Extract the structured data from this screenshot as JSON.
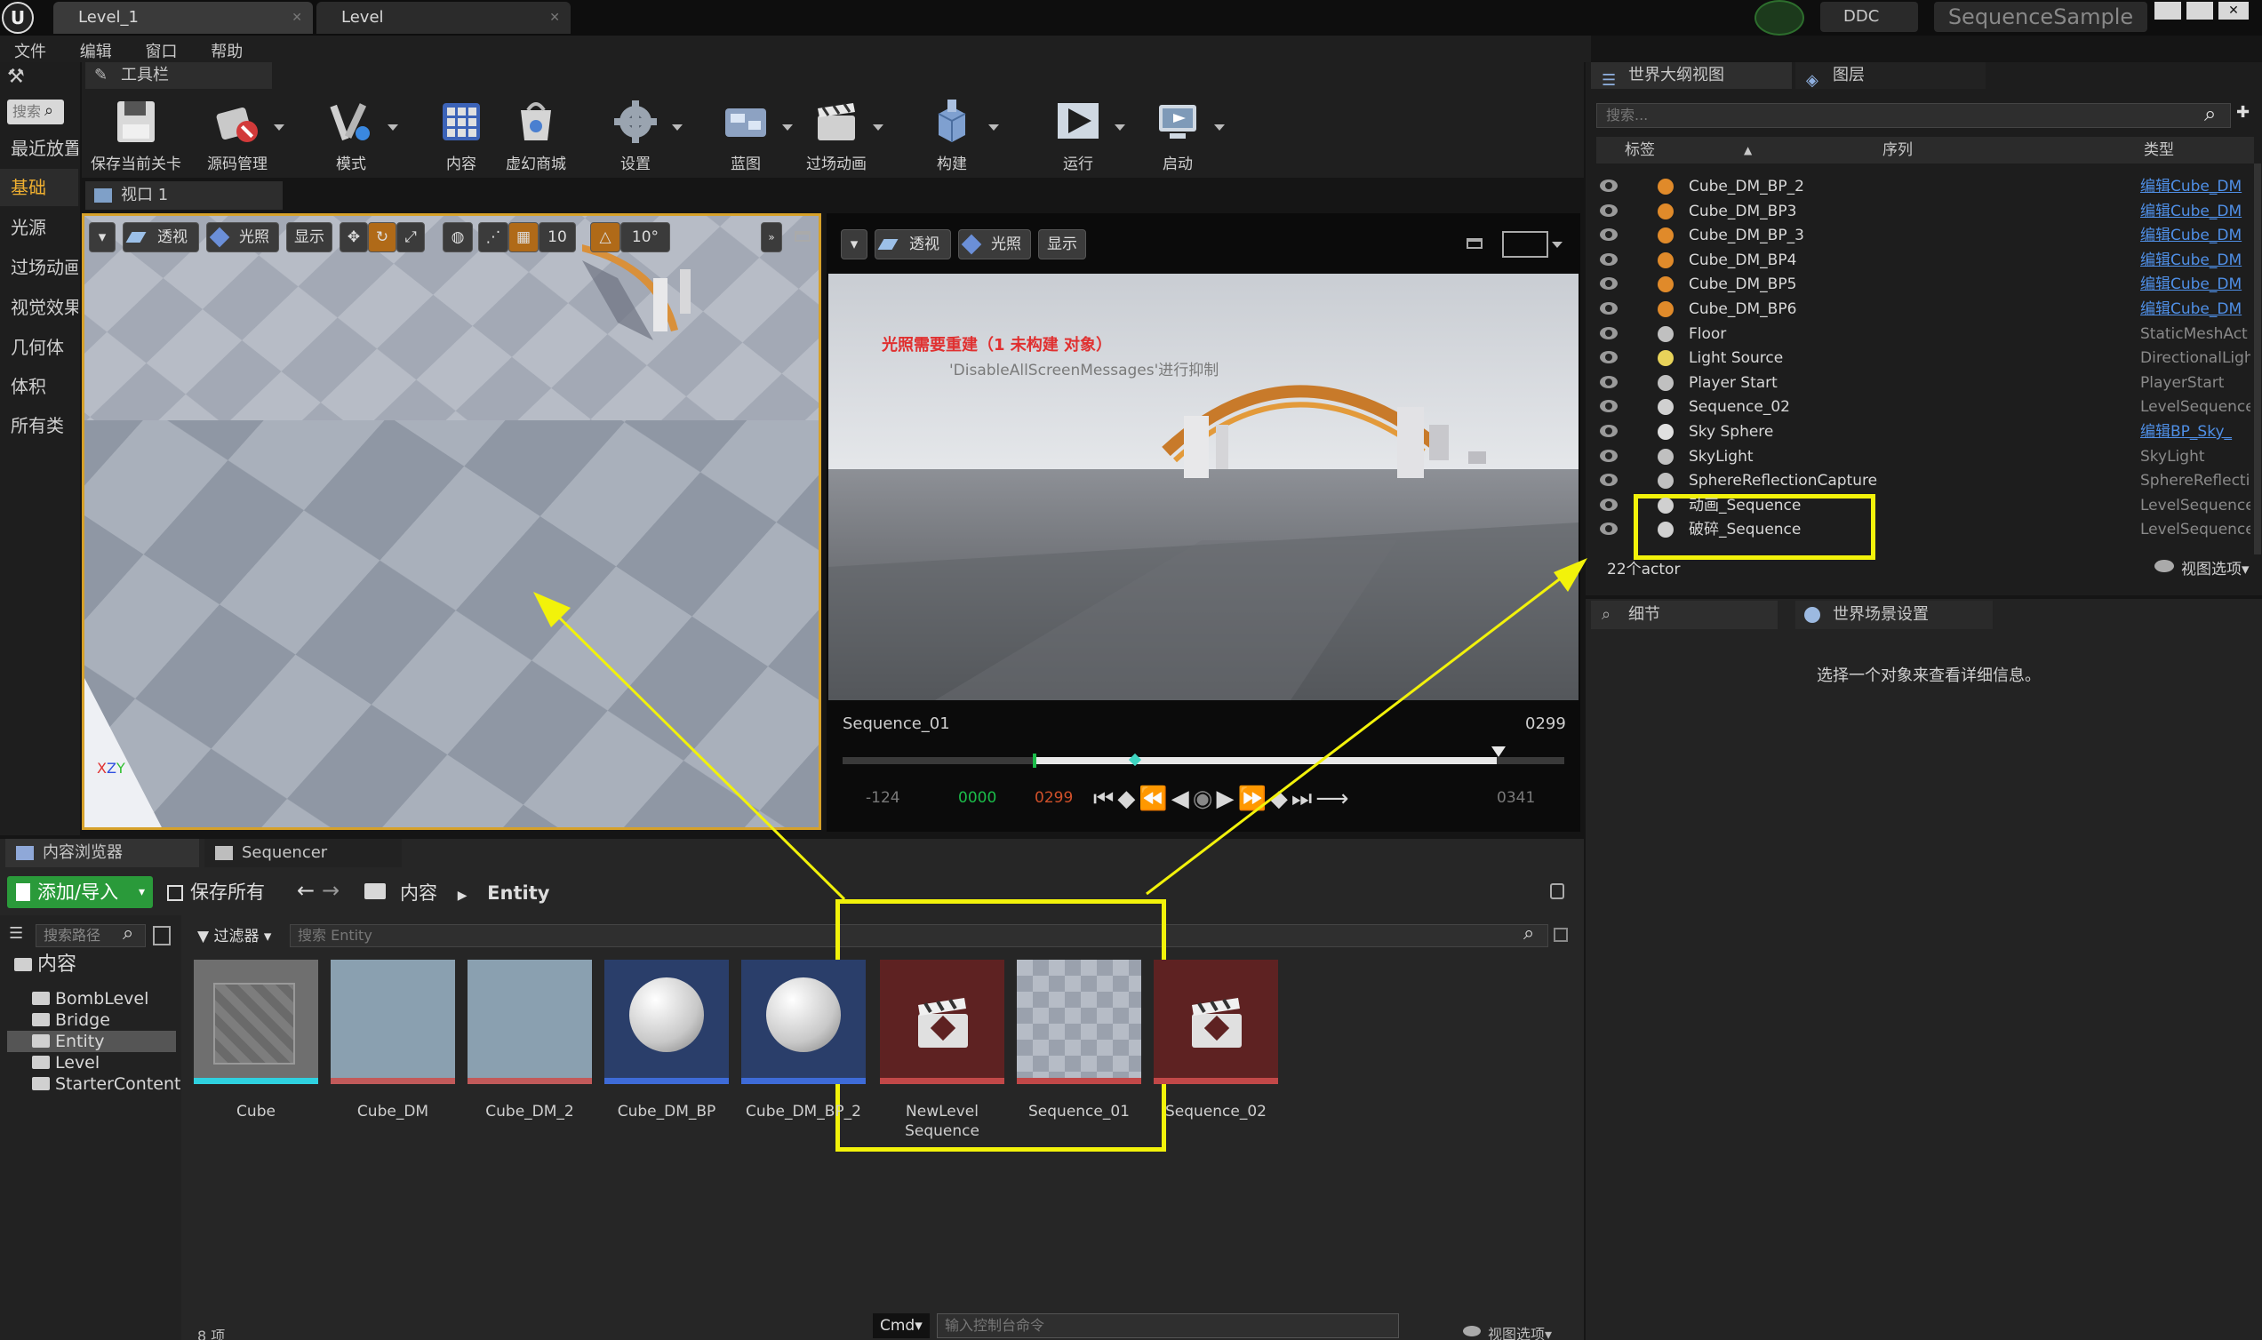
{
  "window": {
    "tabs": [
      {
        "label": "Level_1"
      },
      {
        "label": "Level"
      }
    ],
    "ddc_label": "DDC",
    "project_name": "SequenceSample"
  },
  "menu": [
    "文件",
    "编辑",
    "窗口",
    "帮助"
  ],
  "toolbar": {
    "tab_label": "工具栏",
    "buttons": [
      {
        "label": "保存当前关卡",
        "icon": "save-icon"
      },
      {
        "label": "源码管理",
        "icon": "source-control-icon"
      },
      {
        "label": "模式",
        "icon": "modes-icon"
      },
      {
        "label": "内容",
        "icon": "content-icon"
      },
      {
        "label": "虚幻商城",
        "icon": "marketplace-icon"
      },
      {
        "label": "设置",
        "icon": "settings-icon"
      },
      {
        "label": "蓝图",
        "icon": "blueprint-icon"
      },
      {
        "label": "过场动画",
        "icon": "cinematics-icon"
      },
      {
        "label": "构建",
        "icon": "build-icon"
      },
      {
        "label": "运行",
        "icon": "play-icon"
      },
      {
        "label": "启动",
        "icon": "launch-icon"
      }
    ]
  },
  "modes_panel": {
    "search_placeholder": "搜索",
    "categories": [
      "最近放置",
      "基础",
      "光源",
      "过场动画",
      "视觉效果",
      "几何体",
      "体积",
      "所有类"
    ]
  },
  "viewport": {
    "tab_label": "视口 1",
    "buttons": {
      "perspective": "透视",
      "lit": "光照",
      "show": "显示"
    },
    "grid_snap": "10",
    "rotation_snap": "10°"
  },
  "cine_viewport": {
    "buttons": {
      "perspective": "透视",
      "lit": "光照",
      "show": "显示"
    },
    "warning_text": "光照需要重建（1 未构建 对象）",
    "sub_text": "'DisableAllScreenMessages'进行抑制",
    "sequence_name": "Sequence_01",
    "end_frame": "0299",
    "time_start_out": "-124",
    "time_start": "0000",
    "time_end": "0299",
    "time_end_out": "0341"
  },
  "outliner": {
    "tabs": [
      "世界大纲视图",
      "图层"
    ],
    "search_placeholder": "搜索...",
    "columns": [
      "标签",
      "序列",
      "类型"
    ],
    "rows": [
      {
        "label": "Cube_DM_BP_2",
        "type": "编辑Cube_DM",
        "link": true,
        "color": "#e08a2a"
      },
      {
        "label": "Cube_DM_BP3",
        "type": "编辑Cube_DM",
        "link": true,
        "color": "#e08a2a"
      },
      {
        "label": "Cube_DM_BP_3",
        "type": "编辑Cube_DM",
        "link": true,
        "color": "#e08a2a"
      },
      {
        "label": "Cube_DM_BP4",
        "type": "编辑Cube_DM",
        "link": true,
        "color": "#e08a2a"
      },
      {
        "label": "Cube_DM_BP5",
        "type": "编辑Cube_DM",
        "link": true,
        "color": "#e08a2a"
      },
      {
        "label": "Cube_DM_BP6",
        "type": "编辑Cube_DM",
        "link": true,
        "color": "#e08a2a"
      },
      {
        "label": "Floor",
        "type": "StaticMeshAct",
        "link": false,
        "color": "#c0c0c0"
      },
      {
        "label": "Light Source",
        "type": "DirectionalLigh",
        "link": false,
        "color": "#e8d35a"
      },
      {
        "label": "Player Start",
        "type": "PlayerStart",
        "link": false,
        "color": "#c0c0c0"
      },
      {
        "label": "Sequence_02",
        "type": "LevelSequence",
        "link": false,
        "color": "#d0d0d0"
      },
      {
        "label": "Sky Sphere",
        "type": "编辑BP_Sky_",
        "link": true,
        "color": "#e0e0e0"
      },
      {
        "label": "SkyLight",
        "type": "SkyLight",
        "link": false,
        "color": "#c0c0c0"
      },
      {
        "label": "SphereReflectionCapture",
        "type": "SphereReflecti",
        "link": false,
        "color": "#c0c0c0"
      },
      {
        "label": "动画_Sequence",
        "type": "LevelSequence",
        "link": false,
        "color": "#d0d0d0"
      },
      {
        "label": "破碎_Sequence",
        "type": "LevelSequence",
        "link": false,
        "color": "#d0d0d0"
      }
    ],
    "actor_count": "22个actor",
    "view_options": "视图选项"
  },
  "details": {
    "tabs": [
      "细节",
      "世界场景设置"
    ],
    "empty_text": "选择一个对象来查看详细信息。"
  },
  "content_browser": {
    "tabs": [
      "内容浏览器",
      "Sequencer"
    ],
    "add_import": "添加/导入",
    "save_all": "保存所有",
    "path": [
      "内容",
      "Entity"
    ],
    "search_paths_placeholder": "搜索路径",
    "filters_label": "过滤器",
    "search_placeholder": "搜索 Entity",
    "tree": [
      {
        "label": "内容",
        "root": true,
        "selected": false
      },
      {
        "label": "BombLevel",
        "root": false,
        "selected": false
      },
      {
        "label": "Bridge",
        "root": false,
        "selected": false
      },
      {
        "label": "Entity",
        "root": false,
        "selected": true
      },
      {
        "label": "Level",
        "root": false,
        "selected": false
      },
      {
        "label": "StarterContent",
        "root": false,
        "selected": false
      }
    ],
    "assets": [
      {
        "name": "Cube",
        "kind": "cube",
        "bar": "#2fd1e0"
      },
      {
        "name": "Cube_DM",
        "kind": "flat",
        "bar": "#c25a5a"
      },
      {
        "name": "Cube_DM_2",
        "kind": "flat",
        "bar": "#c25a5a"
      },
      {
        "name": "Cube_DM_BP",
        "kind": "sphere",
        "bar": "#3e6bd8"
      },
      {
        "name": "Cube_DM_BP_2",
        "kind": "sphere",
        "bar": "#3e6bd8"
      },
      {
        "name": "NewLevel Sequence",
        "kind": "clap",
        "bar": "#c24848"
      },
      {
        "name": "Sequence_01",
        "kind": "grid",
        "bar": "#c24848"
      },
      {
        "name": "Sequence_02",
        "kind": "clap",
        "bar": "#c24848"
      }
    ],
    "item_count": "8 项",
    "cmd_label": "Cmd",
    "console_placeholder": "输入控制台命令",
    "view_options": "视图选项"
  }
}
